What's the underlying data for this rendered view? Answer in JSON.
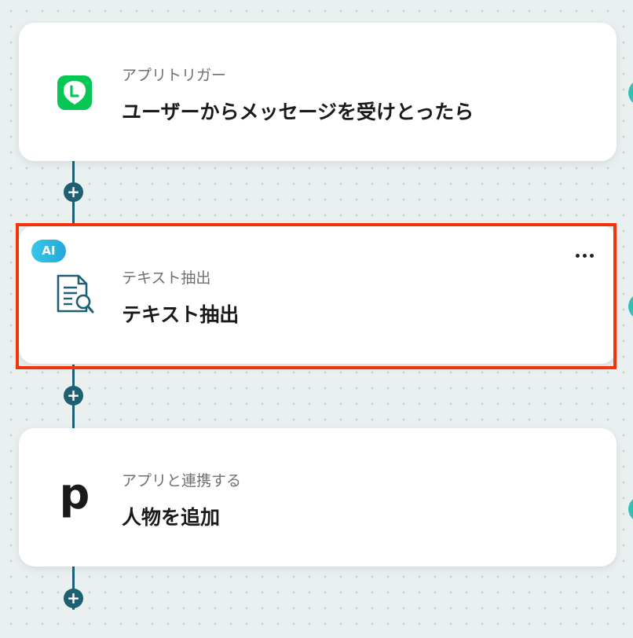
{
  "workflow": {
    "steps": [
      {
        "type_label": "アプリトリガー",
        "title": "ユーザーからメッセージを受けとったら",
        "icon": "line-icon"
      },
      {
        "type_label": "テキスト抽出",
        "title": "テキスト抽出",
        "icon": "document-search-icon",
        "badge": "AI",
        "selected": true
      },
      {
        "type_label": "アプリと連携する",
        "title": "人物を追加",
        "icon": "pipedrive-icon",
        "icon_text": "p"
      }
    ],
    "add_label": "+"
  },
  "colors": {
    "connector": "#1d5f73",
    "selected_border": "#f4320c",
    "line_green": "#06c755",
    "ai_badge": "#2fb6e0",
    "side_accent": "#2fc2b8"
  }
}
